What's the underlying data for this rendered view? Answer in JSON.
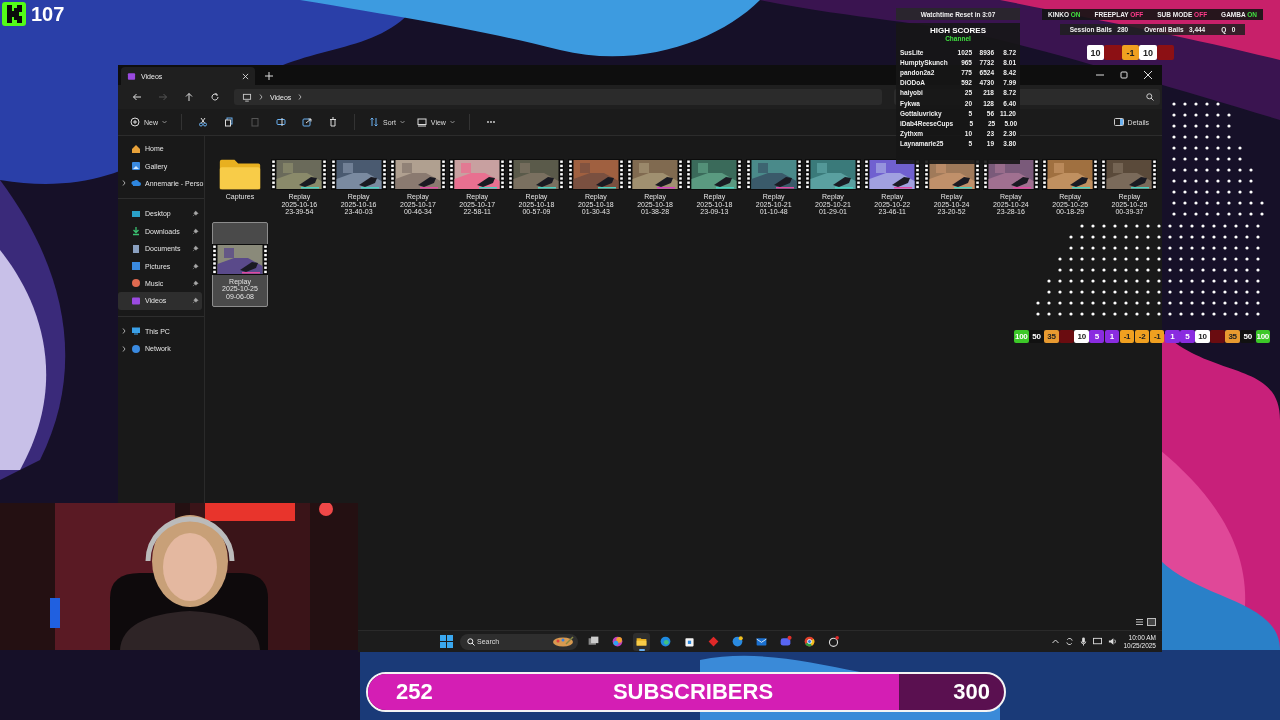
{
  "stream_badge": {
    "count": "107"
  },
  "explorer": {
    "tabs": [
      {
        "label": "Videos",
        "selected": true
      }
    ],
    "nav_buttons": [
      {
        "kind": "back",
        "disabled": false
      },
      {
        "kind": "forward",
        "disabled": true
      },
      {
        "kind": "up",
        "disabled": false
      },
      {
        "kind": "refresh",
        "disabled": false
      }
    ],
    "address": {
      "path": [
        "Videos"
      ]
    },
    "toolbar": [
      {
        "kind": "new",
        "label": "New",
        "disabled": false
      },
      {
        "kind": "cut",
        "disabled": false
      },
      {
        "kind": "copy",
        "disabled": false
      },
      {
        "kind": "paste",
        "disabled": true
      },
      {
        "kind": "rename",
        "disabled": false
      },
      {
        "kind": "share",
        "disabled": false
      },
      {
        "kind": "delete",
        "disabled": false
      },
      {
        "kind": "sort",
        "label": "Sort",
        "disabled": false
      },
      {
        "kind": "view",
        "label": "View",
        "disabled": false
      },
      {
        "kind": "more",
        "disabled": false
      }
    ],
    "details_button": "Details",
    "sidebar": [
      [
        {
          "kind": "home",
          "label": "Home",
          "selected": false,
          "pinned": false,
          "expandable": false
        },
        {
          "kind": "gallery",
          "label": "Gallery",
          "selected": false,
          "pinned": false,
          "expandable": false
        },
        {
          "kind": "cloud",
          "label": "Annemarie - Perso",
          "selected": false,
          "pinned": false,
          "expandable": true
        }
      ],
      [
        {
          "kind": "desktop",
          "label": "Desktop",
          "selected": false,
          "pinned": true,
          "expandable": false
        },
        {
          "kind": "downloads",
          "label": "Downloads",
          "selected": false,
          "pinned": true,
          "expandable": false
        },
        {
          "kind": "documents",
          "label": "Documents",
          "selected": false,
          "pinned": true,
          "expandable": false
        },
        {
          "kind": "pictures",
          "label": "Pictures",
          "selected": false,
          "pinned": true,
          "expandable": false
        },
        {
          "kind": "music",
          "label": "Music",
          "selected": false,
          "pinned": true,
          "expandable": false
        },
        {
          "kind": "videos",
          "label": "Videos",
          "selected": true,
          "pinned": true,
          "expandable": false
        }
      ],
      [
        {
          "kind": "pc",
          "label": "This PC",
          "selected": false,
          "pinned": false,
          "expandable": true
        },
        {
          "kind": "network",
          "label": "Network",
          "selected": false,
          "pinned": false,
          "expandable": true
        }
      ]
    ],
    "items": [
      {
        "kind": "folder",
        "name": "Captures",
        "selected": false
      },
      {
        "kind": "video",
        "name": "Replay",
        "date": "2025-10-16",
        "time": "23-39-54",
        "selected": false
      },
      {
        "kind": "video",
        "name": "Replay",
        "date": "2025-10-16",
        "time": "23-40-03",
        "selected": false
      },
      {
        "kind": "video",
        "name": "Replay",
        "date": "2025-10-17",
        "time": "00-46-34",
        "selected": false
      },
      {
        "kind": "video",
        "name": "Replay",
        "date": "2025-10-17",
        "time": "22-58-11",
        "selected": false
      },
      {
        "kind": "video",
        "name": "Replay",
        "date": "2025-10-18",
        "time": "00-57-09",
        "selected": false
      },
      {
        "kind": "video",
        "name": "Replay",
        "date": "2025-10-18",
        "time": "01-30-43",
        "selected": false
      },
      {
        "kind": "video",
        "name": "Replay",
        "date": "2025-10-18",
        "time": "01-38-28",
        "selected": false
      },
      {
        "kind": "video",
        "name": "Replay",
        "date": "2025-10-18",
        "time": "23-09-13",
        "selected": false
      },
      {
        "kind": "video",
        "name": "Replay",
        "date": "2025-10-21",
        "time": "01-10-48",
        "selected": false
      },
      {
        "kind": "video",
        "name": "Replay",
        "date": "2025-10-21",
        "time": "01-29-01",
        "selected": false
      },
      {
        "kind": "video",
        "name": "Replay",
        "date": "2025-10-22",
        "time": "23-46-11",
        "selected": false
      },
      {
        "kind": "video",
        "name": "Replay",
        "date": "2025-10-24",
        "time": "23-20-52",
        "selected": false
      },
      {
        "kind": "video",
        "name": "Replay",
        "date": "2025-10-24",
        "time": "23-28-16",
        "selected": false
      },
      {
        "kind": "video",
        "name": "Replay",
        "date": "2025-10-25",
        "time": "00-18-29",
        "selected": false
      },
      {
        "kind": "video",
        "name": "Replay",
        "date": "2025-10-25",
        "time": "00-39-37",
        "selected": false
      },
      {
        "kind": "video",
        "name": "Replay",
        "date": "2025-10-25",
        "time": "09-06-08",
        "selected": true
      }
    ]
  },
  "taskbar": {
    "search_placeholder": "Search",
    "apps": [
      {
        "kind": "taskview",
        "active": false
      },
      {
        "kind": "copilot",
        "active": false
      },
      {
        "kind": "explorer",
        "active": true
      },
      {
        "kind": "edge",
        "active": false
      },
      {
        "kind": "store",
        "active": false
      },
      {
        "kind": "diamond",
        "active": false
      },
      {
        "kind": "help",
        "active": false
      },
      {
        "kind": "mail",
        "active": false
      },
      {
        "kind": "discord",
        "active": false
      },
      {
        "kind": "chrome",
        "active": false
      },
      {
        "kind": "app",
        "active": false
      }
    ],
    "time": "10:00 AM",
    "date": "10/25/2025"
  },
  "overlay": {
    "watchtime": "Watchtime Reset in 3:07",
    "toggles": [
      {
        "label": "KINKO",
        "value": "ON",
        "on": true
      },
      {
        "label": "FREEPLAY",
        "value": "OFF",
        "on": false
      },
      {
        "label": "SUB MODE",
        "value": "OFF",
        "on": false
      },
      {
        "label": "GAMBA",
        "value": "ON",
        "on": true
      }
    ],
    "stats": [
      {
        "label": "Session Balls",
        "value": "280"
      },
      {
        "label": "Overall Balls",
        "value": "3,444"
      },
      {
        "label": "Q",
        "value": "0"
      }
    ],
    "score_strip": [
      {
        "label": "10",
        "color": "#ffffff"
      },
      {
        "color": "#8c1014"
      },
      {
        "label": "-1",
        "color": "#f0a020"
      },
      {
        "label": "10",
        "color": "#ffffff"
      },
      {
        "color": "#8c1014"
      }
    ],
    "high_scores": {
      "title": "HIGH SCORES",
      "subtitle": "Channel",
      "rows": [
        {
          "name": "SusLite",
          "values": [
            "1025",
            "8936",
            "8.72"
          ]
        },
        {
          "name": "HumptySkunch",
          "values": [
            "965",
            "7732",
            "8.01"
          ]
        },
        {
          "name": "pandon2a2",
          "values": [
            "775",
            "6524",
            "8.42"
          ]
        },
        {
          "name": "DiODoA",
          "values": [
            "592",
            "4730",
            "7.99"
          ]
        },
        {
          "name": "haiyobi",
          "values": [
            "25",
            "218",
            "8.72"
          ]
        },
        {
          "name": "Fykwa",
          "values": [
            "20",
            "128",
            "6.40"
          ]
        },
        {
          "name": "Gottaluvricky",
          "values": [
            "5",
            "56",
            "11.20"
          ]
        },
        {
          "name": "iDab4ReeseCups",
          "values": [
            "5",
            "25",
            "5.00"
          ]
        },
        {
          "name": "Zythxm",
          "values": [
            "10",
            "23",
            "2.30"
          ]
        },
        {
          "name": "Laynamarie25",
          "values": [
            "5",
            "19",
            "3.80"
          ]
        }
      ]
    }
  },
  "multiplier_strip": [
    {
      "label": "100",
      "color": "#3cc828"
    },
    {
      "label": "50",
      "color": "#111111"
    },
    {
      "label": "35",
      "color": "#e89a30"
    },
    {
      "color": "#6a0c10"
    },
    {
      "label": "10",
      "color": "#ffffff"
    },
    {
      "label": "5",
      "color": "#8a2ce0"
    },
    {
      "label": "1",
      "color": "#8a2ce0"
    },
    {
      "label": "-1",
      "color": "#f0a020"
    },
    {
      "label": "-2",
      "color": "#f0a020"
    },
    {
      "label": "-1",
      "color": "#f0a020"
    },
    {
      "label": "1",
      "color": "#8a2ce0"
    },
    {
      "label": "5",
      "color": "#8a2ce0"
    },
    {
      "label": "10",
      "color": "#ffffff"
    },
    {
      "color": "#6a0c10"
    },
    {
      "label": "35",
      "color": "#e89a30"
    },
    {
      "label": "50",
      "color": "#111111"
    },
    {
      "label": "100",
      "color": "#3cc828"
    }
  ],
  "subscribers": {
    "current": "252",
    "label": "SUBSCRIBERS",
    "goal": "300",
    "level": 0.835
  }
}
